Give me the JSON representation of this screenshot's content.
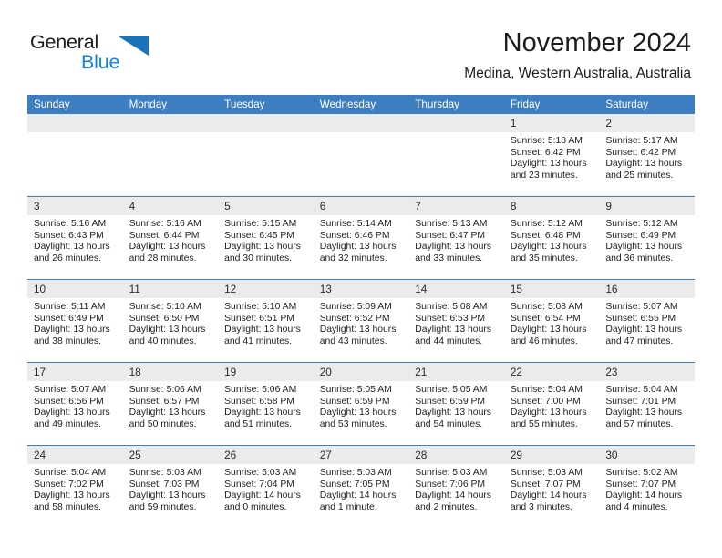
{
  "brand": {
    "name_primary": "General",
    "name_secondary": "Blue",
    "logo_icon": "triangle-flag-icon",
    "accent_color": "#1184d6"
  },
  "header": {
    "title": "November 2024",
    "location": "Medina, Western Australia, Australia"
  },
  "theme": {
    "header_row_color": "#3c7ebf",
    "daynum_band_color": "#ebebeb",
    "text_color": "#1e1e1e"
  },
  "weekday_headers": [
    "Sunday",
    "Monday",
    "Tuesday",
    "Wednesday",
    "Thursday",
    "Friday",
    "Saturday"
  ],
  "weeks": [
    [
      {
        "day": "",
        "empty": true,
        "sunrise": "",
        "sunset": "",
        "daylight_line1": "",
        "daylight_line2": ""
      },
      {
        "day": "",
        "empty": true,
        "sunrise": "",
        "sunset": "",
        "daylight_line1": "",
        "daylight_line2": ""
      },
      {
        "day": "",
        "empty": true,
        "sunrise": "",
        "sunset": "",
        "daylight_line1": "",
        "daylight_line2": ""
      },
      {
        "day": "",
        "empty": true,
        "sunrise": "",
        "sunset": "",
        "daylight_line1": "",
        "daylight_line2": ""
      },
      {
        "day": "",
        "empty": true,
        "sunrise": "",
        "sunset": "",
        "daylight_line1": "",
        "daylight_line2": ""
      },
      {
        "day": "1",
        "empty": false,
        "sunrise": "Sunrise: 5:18 AM",
        "sunset": "Sunset: 6:42 PM",
        "daylight_line1": "Daylight: 13 hours",
        "daylight_line2": "and 23 minutes."
      },
      {
        "day": "2",
        "empty": false,
        "sunrise": "Sunrise: 5:17 AM",
        "sunset": "Sunset: 6:42 PM",
        "daylight_line1": "Daylight: 13 hours",
        "daylight_line2": "and 25 minutes."
      }
    ],
    [
      {
        "day": "3",
        "empty": false,
        "sunrise": "Sunrise: 5:16 AM",
        "sunset": "Sunset: 6:43 PM",
        "daylight_line1": "Daylight: 13 hours",
        "daylight_line2": "and 26 minutes."
      },
      {
        "day": "4",
        "empty": false,
        "sunrise": "Sunrise: 5:16 AM",
        "sunset": "Sunset: 6:44 PM",
        "daylight_line1": "Daylight: 13 hours",
        "daylight_line2": "and 28 minutes."
      },
      {
        "day": "5",
        "empty": false,
        "sunrise": "Sunrise: 5:15 AM",
        "sunset": "Sunset: 6:45 PM",
        "daylight_line1": "Daylight: 13 hours",
        "daylight_line2": "and 30 minutes."
      },
      {
        "day": "6",
        "empty": false,
        "sunrise": "Sunrise: 5:14 AM",
        "sunset": "Sunset: 6:46 PM",
        "daylight_line1": "Daylight: 13 hours",
        "daylight_line2": "and 32 minutes."
      },
      {
        "day": "7",
        "empty": false,
        "sunrise": "Sunrise: 5:13 AM",
        "sunset": "Sunset: 6:47 PM",
        "daylight_line1": "Daylight: 13 hours",
        "daylight_line2": "and 33 minutes."
      },
      {
        "day": "8",
        "empty": false,
        "sunrise": "Sunrise: 5:12 AM",
        "sunset": "Sunset: 6:48 PM",
        "daylight_line1": "Daylight: 13 hours",
        "daylight_line2": "and 35 minutes."
      },
      {
        "day": "9",
        "empty": false,
        "sunrise": "Sunrise: 5:12 AM",
        "sunset": "Sunset: 6:49 PM",
        "daylight_line1": "Daylight: 13 hours",
        "daylight_line2": "and 36 minutes."
      }
    ],
    [
      {
        "day": "10",
        "empty": false,
        "sunrise": "Sunrise: 5:11 AM",
        "sunset": "Sunset: 6:49 PM",
        "daylight_line1": "Daylight: 13 hours",
        "daylight_line2": "and 38 minutes."
      },
      {
        "day": "11",
        "empty": false,
        "sunrise": "Sunrise: 5:10 AM",
        "sunset": "Sunset: 6:50 PM",
        "daylight_line1": "Daylight: 13 hours",
        "daylight_line2": "and 40 minutes."
      },
      {
        "day": "12",
        "empty": false,
        "sunrise": "Sunrise: 5:10 AM",
        "sunset": "Sunset: 6:51 PM",
        "daylight_line1": "Daylight: 13 hours",
        "daylight_line2": "and 41 minutes."
      },
      {
        "day": "13",
        "empty": false,
        "sunrise": "Sunrise: 5:09 AM",
        "sunset": "Sunset: 6:52 PM",
        "daylight_line1": "Daylight: 13 hours",
        "daylight_line2": "and 43 minutes."
      },
      {
        "day": "14",
        "empty": false,
        "sunrise": "Sunrise: 5:08 AM",
        "sunset": "Sunset: 6:53 PM",
        "daylight_line1": "Daylight: 13 hours",
        "daylight_line2": "and 44 minutes."
      },
      {
        "day": "15",
        "empty": false,
        "sunrise": "Sunrise: 5:08 AM",
        "sunset": "Sunset: 6:54 PM",
        "daylight_line1": "Daylight: 13 hours",
        "daylight_line2": "and 46 minutes."
      },
      {
        "day": "16",
        "empty": false,
        "sunrise": "Sunrise: 5:07 AM",
        "sunset": "Sunset: 6:55 PM",
        "daylight_line1": "Daylight: 13 hours",
        "daylight_line2": "and 47 minutes."
      }
    ],
    [
      {
        "day": "17",
        "empty": false,
        "sunrise": "Sunrise: 5:07 AM",
        "sunset": "Sunset: 6:56 PM",
        "daylight_line1": "Daylight: 13 hours",
        "daylight_line2": "and 49 minutes."
      },
      {
        "day": "18",
        "empty": false,
        "sunrise": "Sunrise: 5:06 AM",
        "sunset": "Sunset: 6:57 PM",
        "daylight_line1": "Daylight: 13 hours",
        "daylight_line2": "and 50 minutes."
      },
      {
        "day": "19",
        "empty": false,
        "sunrise": "Sunrise: 5:06 AM",
        "sunset": "Sunset: 6:58 PM",
        "daylight_line1": "Daylight: 13 hours",
        "daylight_line2": "and 51 minutes."
      },
      {
        "day": "20",
        "empty": false,
        "sunrise": "Sunrise: 5:05 AM",
        "sunset": "Sunset: 6:59 PM",
        "daylight_line1": "Daylight: 13 hours",
        "daylight_line2": "and 53 minutes."
      },
      {
        "day": "21",
        "empty": false,
        "sunrise": "Sunrise: 5:05 AM",
        "sunset": "Sunset: 6:59 PM",
        "daylight_line1": "Daylight: 13 hours",
        "daylight_line2": "and 54 minutes."
      },
      {
        "day": "22",
        "empty": false,
        "sunrise": "Sunrise: 5:04 AM",
        "sunset": "Sunset: 7:00 PM",
        "daylight_line1": "Daylight: 13 hours",
        "daylight_line2": "and 55 minutes."
      },
      {
        "day": "23",
        "empty": false,
        "sunrise": "Sunrise: 5:04 AM",
        "sunset": "Sunset: 7:01 PM",
        "daylight_line1": "Daylight: 13 hours",
        "daylight_line2": "and 57 minutes."
      }
    ],
    [
      {
        "day": "24",
        "empty": false,
        "sunrise": "Sunrise: 5:04 AM",
        "sunset": "Sunset: 7:02 PM",
        "daylight_line1": "Daylight: 13 hours",
        "daylight_line2": "and 58 minutes."
      },
      {
        "day": "25",
        "empty": false,
        "sunrise": "Sunrise: 5:03 AM",
        "sunset": "Sunset: 7:03 PM",
        "daylight_line1": "Daylight: 13 hours",
        "daylight_line2": "and 59 minutes."
      },
      {
        "day": "26",
        "empty": false,
        "sunrise": "Sunrise: 5:03 AM",
        "sunset": "Sunset: 7:04 PM",
        "daylight_line1": "Daylight: 14 hours",
        "daylight_line2": "and 0 minutes."
      },
      {
        "day": "27",
        "empty": false,
        "sunrise": "Sunrise: 5:03 AM",
        "sunset": "Sunset: 7:05 PM",
        "daylight_line1": "Daylight: 14 hours",
        "daylight_line2": "and 1 minute."
      },
      {
        "day": "28",
        "empty": false,
        "sunrise": "Sunrise: 5:03 AM",
        "sunset": "Sunset: 7:06 PM",
        "daylight_line1": "Daylight: 14 hours",
        "daylight_line2": "and 2 minutes."
      },
      {
        "day": "29",
        "empty": false,
        "sunrise": "Sunrise: 5:03 AM",
        "sunset": "Sunset: 7:07 PM",
        "daylight_line1": "Daylight: 14 hours",
        "daylight_line2": "and 3 minutes."
      },
      {
        "day": "30",
        "empty": false,
        "sunrise": "Sunrise: 5:02 AM",
        "sunset": "Sunset: 7:07 PM",
        "daylight_line1": "Daylight: 14 hours",
        "daylight_line2": "and 4 minutes."
      }
    ]
  ]
}
